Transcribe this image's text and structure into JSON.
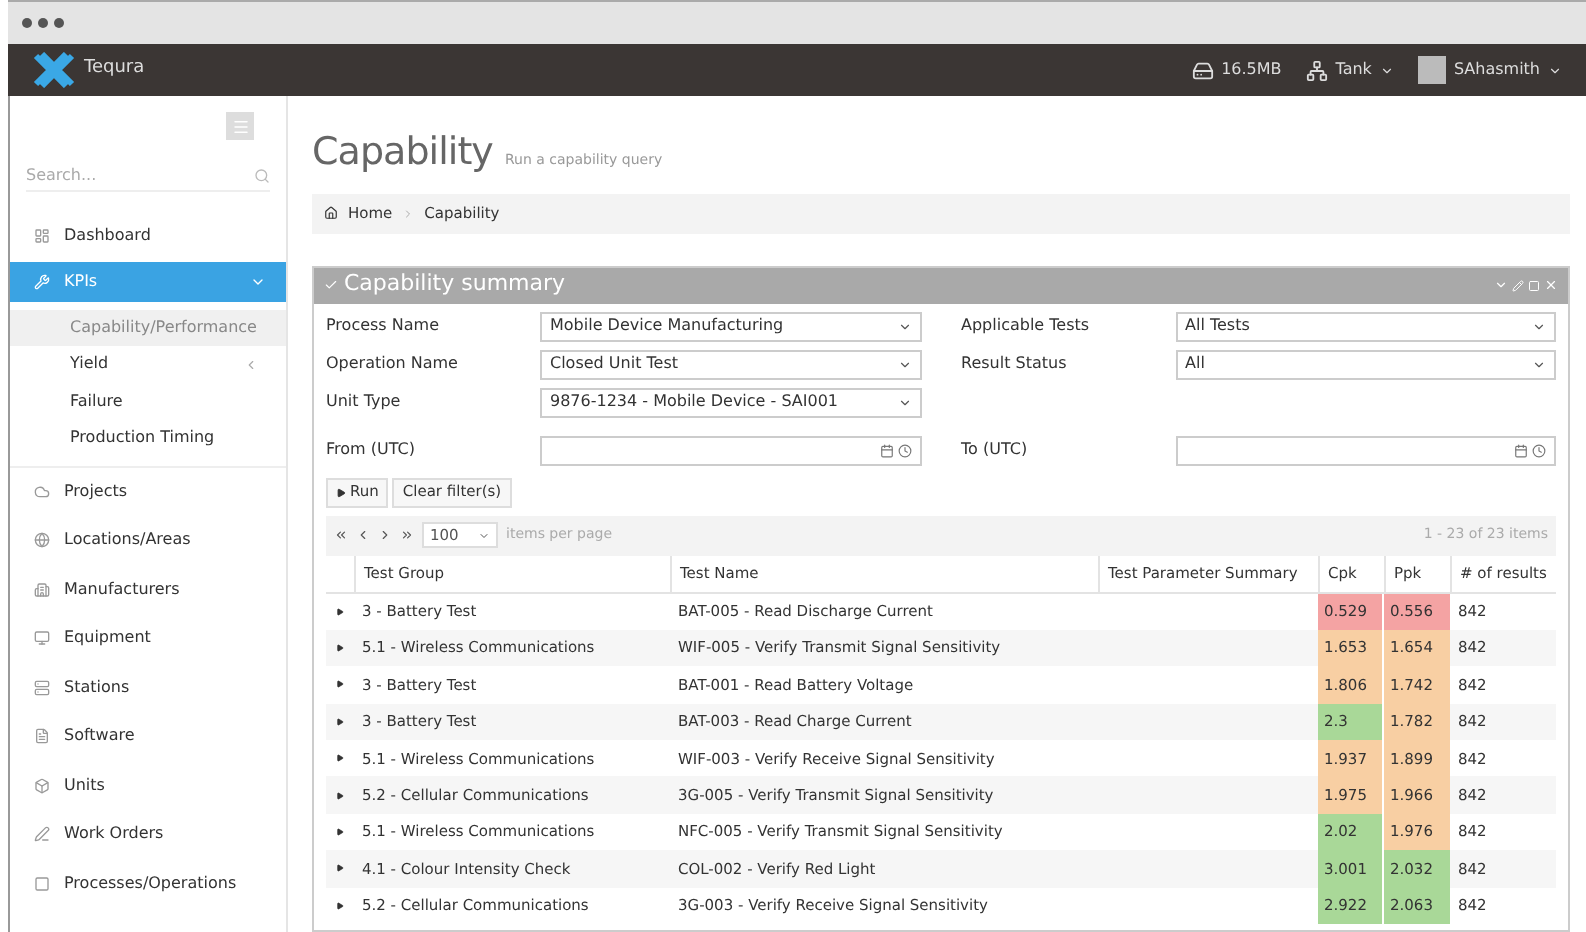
{
  "app": {
    "name": "Tequra",
    "memory": "16.5MB",
    "site": "Tank",
    "user": "SAhasmith"
  },
  "sidebar": {
    "search": {
      "placeholder": "Search..."
    },
    "items": [
      {
        "label": "Dashboard",
        "selected": false
      },
      {
        "label": "KPIs",
        "selected": true,
        "expanded": true,
        "children": [
          {
            "label": "Capability/Performance",
            "selected": true,
            "has_arrow": false
          },
          {
            "label": "Yield",
            "selected": false,
            "has_arrow": true
          },
          {
            "label": "Failure",
            "selected": false,
            "has_arrow": false
          },
          {
            "label": "Production Timing",
            "selected": false,
            "has_arrow": false
          }
        ]
      },
      {
        "label": "Projects",
        "selected": false
      },
      {
        "label": "Locations/Areas",
        "selected": false
      },
      {
        "label": "Manufacturers",
        "selected": false
      },
      {
        "label": "Equipment",
        "selected": false
      },
      {
        "label": "Stations",
        "selected": false
      },
      {
        "label": "Software",
        "selected": false
      },
      {
        "label": "Units",
        "selected": false
      },
      {
        "label": "Work Orders",
        "selected": false
      },
      {
        "label": "Processes/Operations",
        "selected": false
      }
    ]
  },
  "page": {
    "title": "Capability",
    "subtitle": "Run a capability query",
    "breadcrumb": [
      "Home",
      "Capability"
    ]
  },
  "panel": {
    "title": "Capability summary",
    "filters_left": [
      {
        "label": "Process Name",
        "value": "Mobile Device Manufacturing"
      },
      {
        "label": "Operation Name",
        "value": "Closed Unit Test"
      },
      {
        "label": "Unit Type",
        "value": "9876-1234 - Mobile Device - SAI001"
      }
    ],
    "filters_right": [
      {
        "label": "Applicable Tests",
        "value": "All Tests"
      },
      {
        "label": "Result Status",
        "value": "All"
      }
    ],
    "dates": [
      {
        "label": "From (UTC)"
      },
      {
        "label": "To (UTC)"
      }
    ],
    "buttons": [
      "Run",
      "Clear filter(s)"
    ],
    "pager": {
      "page_size": "100",
      "page_size_label": "items per page",
      "summary": "1 - 23 of 23 items"
    },
    "columns": [
      "Test Group",
      "Test Name",
      "Test Parameter Summary",
      "Cpk",
      "Ppk",
      "# of results"
    ],
    "rows": [
      {
        "group": "3 - Battery Test",
        "name": "BAT-005 - Read Discharge Current",
        "cpk": {
          "value": "0.529",
          "color": "#f4a3a3"
        },
        "ppk": {
          "value": "0.556",
          "color": "#f4a3a3"
        },
        "results": "842"
      },
      {
        "group": "5.1 - Wireless Communications",
        "name": "WIF-005 - Verify Transmit Signal Sensitivity",
        "cpk": {
          "value": "1.653",
          "color": "#f8cfa3"
        },
        "ppk": {
          "value": "1.654",
          "color": "#f8cfa3"
        },
        "results": "842"
      },
      {
        "group": "3 - Battery Test",
        "name": "BAT-001 - Read Battery Voltage",
        "cpk": {
          "value": "1.806",
          "color": "#f8cfa3"
        },
        "ppk": {
          "value": "1.742",
          "color": "#f8cfa3"
        },
        "results": "842"
      },
      {
        "group": "3 - Battery Test",
        "name": "BAT-003 - Read Charge Current",
        "cpk": {
          "value": "2.3",
          "color": "#a9d898"
        },
        "ppk": {
          "value": "1.782",
          "color": "#f8cfa3"
        },
        "results": "842"
      },
      {
        "group": "5.1 - Wireless Communications",
        "name": "WIF-003 - Verify Receive Signal Sensitivity",
        "cpk": {
          "value": "1.937",
          "color": "#f8cfa3"
        },
        "ppk": {
          "value": "1.899",
          "color": "#f8cfa3"
        },
        "results": "842"
      },
      {
        "group": "5.2 - Cellular Communications",
        "name": "3G-005 - Verify Transmit Signal Sensitivity",
        "cpk": {
          "value": "1.975",
          "color": "#f8cfa3"
        },
        "ppk": {
          "value": "1.966",
          "color": "#f8cfa3"
        },
        "results": "842"
      },
      {
        "group": "5.1 - Wireless Communications",
        "name": "NFC-005 - Verify Transmit Signal Sensitivity",
        "cpk": {
          "value": "2.02",
          "color": "#a9d898"
        },
        "ppk": {
          "value": "1.976",
          "color": "#f8cfa3"
        },
        "results": "842"
      },
      {
        "group": "4.1 - Colour Intensity Check",
        "name": "COL-002 - Verify Red Light",
        "cpk": {
          "value": "3.001",
          "color": "#a9d898"
        },
        "ppk": {
          "value": "2.032",
          "color": "#a9d898"
        },
        "results": "842"
      },
      {
        "group": "5.2 - Cellular Communications",
        "name": "3G-003 - Verify Receive Signal Sensitivity",
        "cpk": {
          "value": "2.922",
          "color": "#a9d898"
        },
        "ppk": {
          "value": "2.063",
          "color": "#a9d898"
        },
        "results": "842"
      }
    ]
  }
}
